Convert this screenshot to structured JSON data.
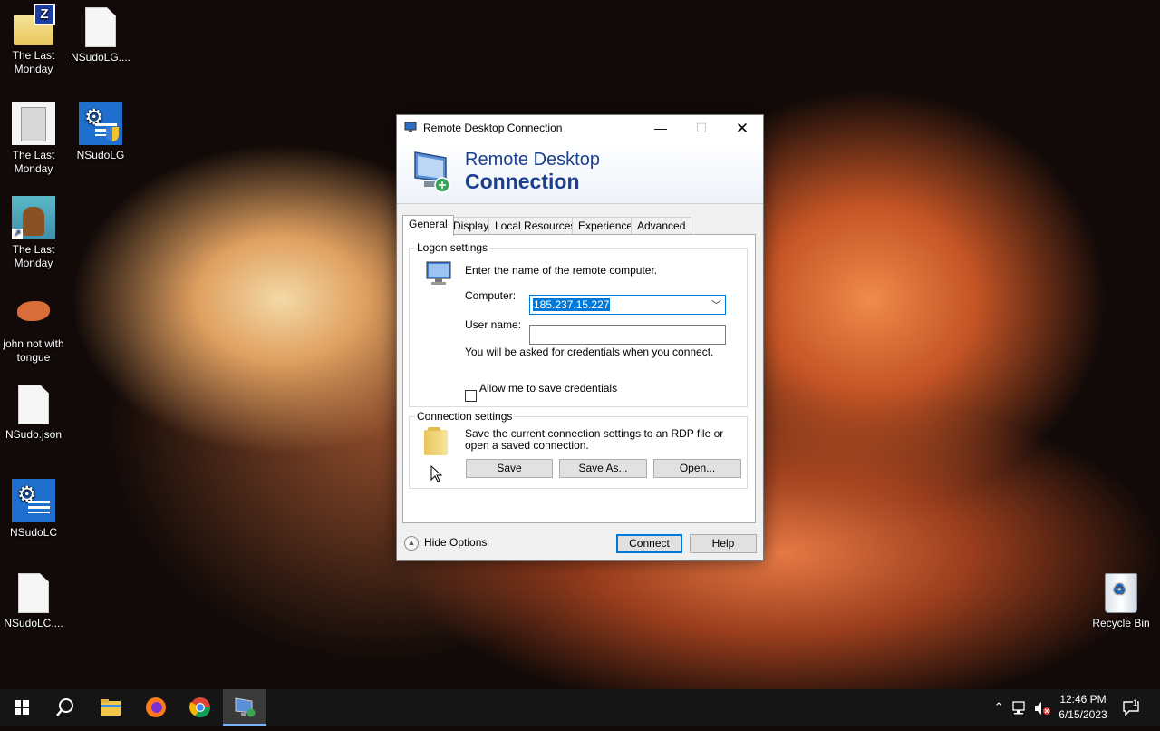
{
  "desktop": {
    "icons": [
      {
        "label": "The Last Monday",
        "icon": "zip-folder-icon"
      },
      {
        "label": "NSudoLG....",
        "icon": "file-icon"
      },
      {
        "label": "The Last Monday",
        "icon": "document-icon"
      },
      {
        "label": "NSudoLG",
        "icon": "nsudo-app-icon"
      },
      {
        "label": "The Last Monday",
        "icon": "image-shortcut-icon"
      },
      {
        "label": "john not with tongue",
        "icon": "image-icon"
      },
      {
        "label": "NSudo.json",
        "icon": "file-icon"
      },
      {
        "label": "NSudoLC",
        "icon": "nsudo-app-icon"
      },
      {
        "label": "NSudoLC....",
        "icon": "file-icon"
      },
      {
        "label": "Recycle Bin",
        "icon": "recycle-bin-icon"
      }
    ]
  },
  "dialog": {
    "title": "Remote Desktop Connection",
    "banner_line1": "Remote Desktop",
    "banner_line2": "Connection",
    "tabs": [
      "General",
      "Display",
      "Local Resources",
      "Experience",
      "Advanced"
    ],
    "active_tab": "General",
    "logon": {
      "group_label": "Logon settings",
      "instruction": "Enter the name of the remote computer.",
      "computer_label": "Computer:",
      "computer_value": "185.237.15.227",
      "username_label": "User name:",
      "username_value": "",
      "credentials_note": "You will be asked for credentials when you connect.",
      "save_credentials_label": "Allow me to save credentials"
    },
    "connection": {
      "group_label": "Connection settings",
      "description": "Save the current connection settings to an RDP file or open a saved connection.",
      "save": "Save",
      "save_as": "Save As...",
      "open": "Open..."
    },
    "hide_options": "Hide Options",
    "connect": "Connect",
    "help": "Help"
  },
  "taskbar": {
    "time": "12:46 PM",
    "date": "6/15/2023",
    "notification_count": "1"
  },
  "colors": {
    "accent": "#0078d7",
    "banner_text": "#1b3f8f",
    "taskbar": "#151515"
  }
}
